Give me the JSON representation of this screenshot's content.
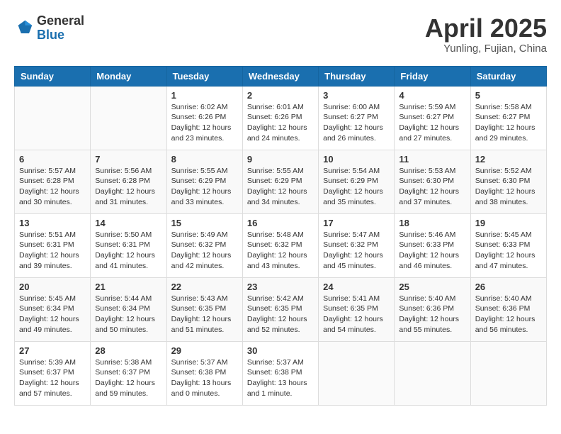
{
  "header": {
    "logo_general": "General",
    "logo_blue": "Blue",
    "month_title": "April 2025",
    "location": "Yunling, Fujian, China"
  },
  "weekdays": [
    "Sunday",
    "Monday",
    "Tuesday",
    "Wednesday",
    "Thursday",
    "Friday",
    "Saturday"
  ],
  "weeks": [
    [
      {
        "day": "",
        "sunrise": "",
        "sunset": "",
        "daylight": ""
      },
      {
        "day": "",
        "sunrise": "",
        "sunset": "",
        "daylight": ""
      },
      {
        "day": "1",
        "sunrise": "Sunrise: 6:02 AM",
        "sunset": "Sunset: 6:26 PM",
        "daylight": "Daylight: 12 hours and 23 minutes."
      },
      {
        "day": "2",
        "sunrise": "Sunrise: 6:01 AM",
        "sunset": "Sunset: 6:26 PM",
        "daylight": "Daylight: 12 hours and 24 minutes."
      },
      {
        "day": "3",
        "sunrise": "Sunrise: 6:00 AM",
        "sunset": "Sunset: 6:27 PM",
        "daylight": "Daylight: 12 hours and 26 minutes."
      },
      {
        "day": "4",
        "sunrise": "Sunrise: 5:59 AM",
        "sunset": "Sunset: 6:27 PM",
        "daylight": "Daylight: 12 hours and 27 minutes."
      },
      {
        "day": "5",
        "sunrise": "Sunrise: 5:58 AM",
        "sunset": "Sunset: 6:27 PM",
        "daylight": "Daylight: 12 hours and 29 minutes."
      }
    ],
    [
      {
        "day": "6",
        "sunrise": "Sunrise: 5:57 AM",
        "sunset": "Sunset: 6:28 PM",
        "daylight": "Daylight: 12 hours and 30 minutes."
      },
      {
        "day": "7",
        "sunrise": "Sunrise: 5:56 AM",
        "sunset": "Sunset: 6:28 PM",
        "daylight": "Daylight: 12 hours and 31 minutes."
      },
      {
        "day": "8",
        "sunrise": "Sunrise: 5:55 AM",
        "sunset": "Sunset: 6:29 PM",
        "daylight": "Daylight: 12 hours and 33 minutes."
      },
      {
        "day": "9",
        "sunrise": "Sunrise: 5:55 AM",
        "sunset": "Sunset: 6:29 PM",
        "daylight": "Daylight: 12 hours and 34 minutes."
      },
      {
        "day": "10",
        "sunrise": "Sunrise: 5:54 AM",
        "sunset": "Sunset: 6:29 PM",
        "daylight": "Daylight: 12 hours and 35 minutes."
      },
      {
        "day": "11",
        "sunrise": "Sunrise: 5:53 AM",
        "sunset": "Sunset: 6:30 PM",
        "daylight": "Daylight: 12 hours and 37 minutes."
      },
      {
        "day": "12",
        "sunrise": "Sunrise: 5:52 AM",
        "sunset": "Sunset: 6:30 PM",
        "daylight": "Daylight: 12 hours and 38 minutes."
      }
    ],
    [
      {
        "day": "13",
        "sunrise": "Sunrise: 5:51 AM",
        "sunset": "Sunset: 6:31 PM",
        "daylight": "Daylight: 12 hours and 39 minutes."
      },
      {
        "day": "14",
        "sunrise": "Sunrise: 5:50 AM",
        "sunset": "Sunset: 6:31 PM",
        "daylight": "Daylight: 12 hours and 41 minutes."
      },
      {
        "day": "15",
        "sunrise": "Sunrise: 5:49 AM",
        "sunset": "Sunset: 6:32 PM",
        "daylight": "Daylight: 12 hours and 42 minutes."
      },
      {
        "day": "16",
        "sunrise": "Sunrise: 5:48 AM",
        "sunset": "Sunset: 6:32 PM",
        "daylight": "Daylight: 12 hours and 43 minutes."
      },
      {
        "day": "17",
        "sunrise": "Sunrise: 5:47 AM",
        "sunset": "Sunset: 6:32 PM",
        "daylight": "Daylight: 12 hours and 45 minutes."
      },
      {
        "day": "18",
        "sunrise": "Sunrise: 5:46 AM",
        "sunset": "Sunset: 6:33 PM",
        "daylight": "Daylight: 12 hours and 46 minutes."
      },
      {
        "day": "19",
        "sunrise": "Sunrise: 5:45 AM",
        "sunset": "Sunset: 6:33 PM",
        "daylight": "Daylight: 12 hours and 47 minutes."
      }
    ],
    [
      {
        "day": "20",
        "sunrise": "Sunrise: 5:45 AM",
        "sunset": "Sunset: 6:34 PM",
        "daylight": "Daylight: 12 hours and 49 minutes."
      },
      {
        "day": "21",
        "sunrise": "Sunrise: 5:44 AM",
        "sunset": "Sunset: 6:34 PM",
        "daylight": "Daylight: 12 hours and 50 minutes."
      },
      {
        "day": "22",
        "sunrise": "Sunrise: 5:43 AM",
        "sunset": "Sunset: 6:35 PM",
        "daylight": "Daylight: 12 hours and 51 minutes."
      },
      {
        "day": "23",
        "sunrise": "Sunrise: 5:42 AM",
        "sunset": "Sunset: 6:35 PM",
        "daylight": "Daylight: 12 hours and 52 minutes."
      },
      {
        "day": "24",
        "sunrise": "Sunrise: 5:41 AM",
        "sunset": "Sunset: 6:35 PM",
        "daylight": "Daylight: 12 hours and 54 minutes."
      },
      {
        "day": "25",
        "sunrise": "Sunrise: 5:40 AM",
        "sunset": "Sunset: 6:36 PM",
        "daylight": "Daylight: 12 hours and 55 minutes."
      },
      {
        "day": "26",
        "sunrise": "Sunrise: 5:40 AM",
        "sunset": "Sunset: 6:36 PM",
        "daylight": "Daylight: 12 hours and 56 minutes."
      }
    ],
    [
      {
        "day": "27",
        "sunrise": "Sunrise: 5:39 AM",
        "sunset": "Sunset: 6:37 PM",
        "daylight": "Daylight: 12 hours and 57 minutes."
      },
      {
        "day": "28",
        "sunrise": "Sunrise: 5:38 AM",
        "sunset": "Sunset: 6:37 PM",
        "daylight": "Daylight: 12 hours and 59 minutes."
      },
      {
        "day": "29",
        "sunrise": "Sunrise: 5:37 AM",
        "sunset": "Sunset: 6:38 PM",
        "daylight": "Daylight: 13 hours and 0 minutes."
      },
      {
        "day": "30",
        "sunrise": "Sunrise: 5:37 AM",
        "sunset": "Sunset: 6:38 PM",
        "daylight": "Daylight: 13 hours and 1 minute."
      },
      {
        "day": "",
        "sunrise": "",
        "sunset": "",
        "daylight": ""
      },
      {
        "day": "",
        "sunrise": "",
        "sunset": "",
        "daylight": ""
      },
      {
        "day": "",
        "sunrise": "",
        "sunset": "",
        "daylight": ""
      }
    ]
  ]
}
